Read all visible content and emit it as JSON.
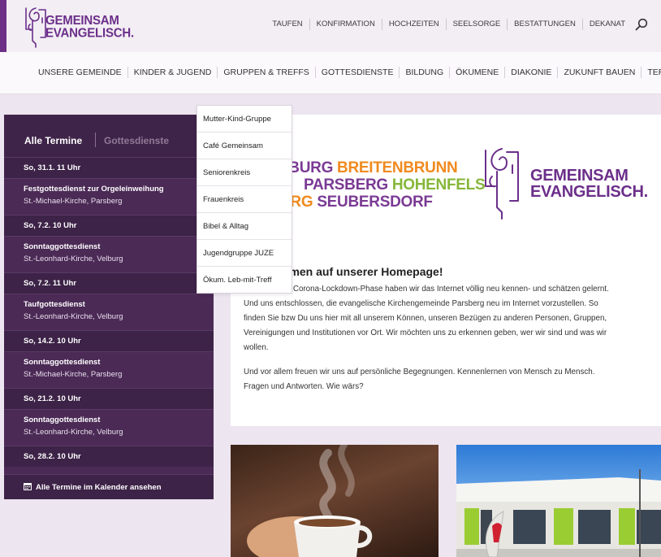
{
  "brand": {
    "line1": "GEMEINSAM",
    "line2": "EVANGELISCH.",
    "color": "#6b2f8a"
  },
  "topnav": [
    "TAUFEN",
    "KONFIRMATION",
    "HOCHZEITEN",
    "SEELSORGE",
    "BESTATTUNGEN",
    "DEKANAT"
  ],
  "mainnav": [
    "UNSERE GEMEINDE",
    "KINDER & JUGEND",
    "GRUPPEN & TREFFS",
    "GOTTESDIENSTE",
    "BILDUNG",
    "ÖKUMENE",
    "DIAKONIE",
    "ZUKUNFT BAUEN",
    "TERMINE"
  ],
  "dropdown": [
    "Mutter-Kind-Gruppe",
    "Café Gemeinsam",
    "Seniorenkreis",
    "Frauenkreis",
    "Bibel & Alltag",
    "Jugendgruppe JUZE",
    "Ökum. Leb-mit-Treff"
  ],
  "termine": {
    "tab_all": "Alle Termine",
    "tab_services": "Gottesdienste",
    "items": [
      {
        "date": "So, 31.1. 11 Uhr",
        "title": "Festgottesdienst zur Orgeleinweihung",
        "place": "St.-Michael-Kirche, Parsberg"
      },
      {
        "date": "So, 7.2. 10 Uhr",
        "title": "Sonntaggottesdienst",
        "place": "St.-Leonhard-Kirche, Velburg"
      },
      {
        "date": "So, 7.2. 11 Uhr",
        "title": "Taufgottesdienst",
        "place": "St.-Leonhard-Kirche, Velburg"
      },
      {
        "date": "So, 14.2. 10 Uhr",
        "title": "Sonntaggottesdienst",
        "place": "St.-Michael-Kirche, Parsberg"
      },
      {
        "date": "So, 21.2. 10 Uhr",
        "title": "Sonntaggottesdienst",
        "place": "St.-Leonhard-Kirche, Velburg"
      },
      {
        "date": "So, 28.2. 10 Uhr",
        "title": "",
        "place": ""
      }
    ],
    "footer": "Alle Termine im Kalender ansehen"
  },
  "towns": {
    "row1a": "LBURG",
    "row1b": "BREITENBRUNN",
    "row2a": "PARSBERG",
    "row2b": "HOHENFELS",
    "row3a": "URG",
    "row3b": "SEUBERSDORF"
  },
  "welcome": {
    "heading": "mmen auf unserer Homepage!",
    "p1_line1": "der Corona-Lockdown-Phase haben wir das Internet völlig neu kennen- und schätzen gelernt.",
    "p1_line2": "Und uns entschlossen, die evangelische Kirchengemeinde Parsberg neu im Internet vorzustellen. So",
    "p1_line3": "finden Sie bzw Du uns hier mit all unserem Können, unseren Bezügen zu anderen Personen, Gruppen,",
    "p1_line4": "Vereinigungen und Institutionen vor Ort. Wir möchten uns zu erkennen geben, wer wir sind und was wir",
    "p1_line5": "wollen.",
    "p2_line1": "Und vor allem freuen wir uns auf persönliche Begegnungen. Kennenlernen von Mensch zu Mensch.",
    "p2_line2": "Fragen und Antworten. Wie wärs?"
  },
  "colors": {
    "accent": "#6b2f8a",
    "sidebar": "#4b2a56",
    "orange": "#f08a1e",
    "green": "#86b73a"
  }
}
